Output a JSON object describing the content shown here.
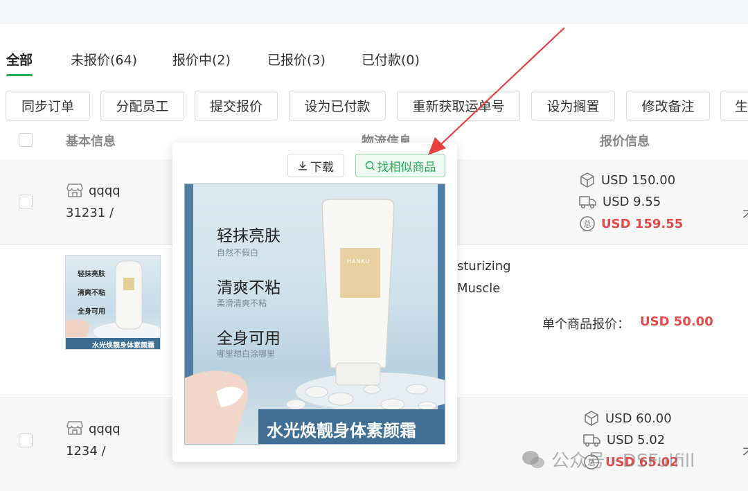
{
  "tabs": [
    {
      "label": "全部",
      "active": true
    },
    {
      "label": "未报价(64)"
    },
    {
      "label": "报价中(2)"
    },
    {
      "label": "已报价(3)"
    },
    {
      "label": "已付款(0)"
    }
  ],
  "toolbar": [
    "同步订单",
    "分配员工",
    "提交报价",
    "设为已付款",
    "重新获取运单号",
    "设为搁置",
    "修改备注",
    "生"
  ],
  "table_headers": {
    "basic": "基本信息",
    "logistics": "物流信息",
    "quote": "报价信息"
  },
  "rows": [
    {
      "shop": "qqqq",
      "order": "31231 /",
      "prices": [
        "USD 150.00",
        "USD 9.55",
        "USD 159.55"
      ],
      "right_edge": "不"
    },
    {
      "desc_line1": "sturizing",
      "desc_line2": "Muscle",
      "unit_label": "单个商品报价：",
      "unit_price": "USD 50.00"
    },
    {
      "shop": "qqqq",
      "order": "1234 /",
      "prices": [
        "USD 60.00",
        "USD 5.02",
        "USD 65.02"
      ],
      "right_edge": "不"
    }
  ],
  "popover": {
    "download_label": "下载",
    "find_similar_label": "找相似商品",
    "image": {
      "lines": [
        {
          "title": "轻抹亮肤",
          "sub": "自然不假白"
        },
        {
          "title": "清爽不粘",
          "sub": "柔滑清爽不粘"
        },
        {
          "title": "全身可用",
          "sub": "哪里想白涂哪里"
        }
      ],
      "brand": "HANKU",
      "banner": "水光焕靓身体素颜霜"
    }
  },
  "thumb": {
    "lines": [
      "轻抹亮肤",
      "清爽不粘",
      "全身可用"
    ],
    "banner": "水光焕靓身体素颜霜"
  },
  "watermark": {
    "text": "公众号 · DSFulfill"
  },
  "colors": {
    "accent_green": "#2bab57",
    "price_red": "#e84a4a",
    "arrow_red": "#e8403b"
  }
}
